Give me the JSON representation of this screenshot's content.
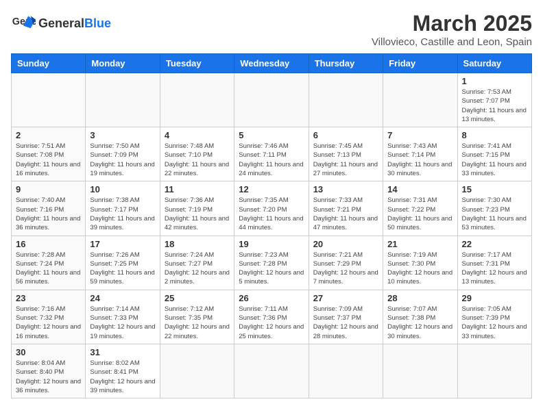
{
  "logo": {
    "text_general": "General",
    "text_blue": "Blue"
  },
  "title": "March 2025",
  "subtitle": "Villovieco, Castille and Leon, Spain",
  "weekdays": [
    "Sunday",
    "Monday",
    "Tuesday",
    "Wednesday",
    "Thursday",
    "Friday",
    "Saturday"
  ],
  "weeks": [
    [
      null,
      null,
      null,
      null,
      null,
      null,
      {
        "day": 1,
        "info": "Sunrise: 7:53 AM\nSunset: 7:07 PM\nDaylight: 11 hours and 13 minutes."
      }
    ],
    [
      {
        "day": 2,
        "info": "Sunrise: 7:51 AM\nSunset: 7:08 PM\nDaylight: 11 hours and 16 minutes."
      },
      {
        "day": 3,
        "info": "Sunrise: 7:50 AM\nSunset: 7:09 PM\nDaylight: 11 hours and 19 minutes."
      },
      {
        "day": 4,
        "info": "Sunrise: 7:48 AM\nSunset: 7:10 PM\nDaylight: 11 hours and 22 minutes."
      },
      {
        "day": 5,
        "info": "Sunrise: 7:46 AM\nSunset: 7:11 PM\nDaylight: 11 hours and 24 minutes."
      },
      {
        "day": 6,
        "info": "Sunrise: 7:45 AM\nSunset: 7:13 PM\nDaylight: 11 hours and 27 minutes."
      },
      {
        "day": 7,
        "info": "Sunrise: 7:43 AM\nSunset: 7:14 PM\nDaylight: 11 hours and 30 minutes."
      },
      {
        "day": 8,
        "info": "Sunrise: 7:41 AM\nSunset: 7:15 PM\nDaylight: 11 hours and 33 minutes."
      }
    ],
    [
      {
        "day": 9,
        "info": "Sunrise: 7:40 AM\nSunset: 7:16 PM\nDaylight: 11 hours and 36 minutes."
      },
      {
        "day": 10,
        "info": "Sunrise: 7:38 AM\nSunset: 7:17 PM\nDaylight: 11 hours and 39 minutes."
      },
      {
        "day": 11,
        "info": "Sunrise: 7:36 AM\nSunset: 7:19 PM\nDaylight: 11 hours and 42 minutes."
      },
      {
        "day": 12,
        "info": "Sunrise: 7:35 AM\nSunset: 7:20 PM\nDaylight: 11 hours and 44 minutes."
      },
      {
        "day": 13,
        "info": "Sunrise: 7:33 AM\nSunset: 7:21 PM\nDaylight: 11 hours and 47 minutes."
      },
      {
        "day": 14,
        "info": "Sunrise: 7:31 AM\nSunset: 7:22 PM\nDaylight: 11 hours and 50 minutes."
      },
      {
        "day": 15,
        "info": "Sunrise: 7:30 AM\nSunset: 7:23 PM\nDaylight: 11 hours and 53 minutes."
      }
    ],
    [
      {
        "day": 16,
        "info": "Sunrise: 7:28 AM\nSunset: 7:24 PM\nDaylight: 11 hours and 56 minutes."
      },
      {
        "day": 17,
        "info": "Sunrise: 7:26 AM\nSunset: 7:25 PM\nDaylight: 11 hours and 59 minutes."
      },
      {
        "day": 18,
        "info": "Sunrise: 7:24 AM\nSunset: 7:27 PM\nDaylight: 12 hours and 2 minutes."
      },
      {
        "day": 19,
        "info": "Sunrise: 7:23 AM\nSunset: 7:28 PM\nDaylight: 12 hours and 5 minutes."
      },
      {
        "day": 20,
        "info": "Sunrise: 7:21 AM\nSunset: 7:29 PM\nDaylight: 12 hours and 7 minutes."
      },
      {
        "day": 21,
        "info": "Sunrise: 7:19 AM\nSunset: 7:30 PM\nDaylight: 12 hours and 10 minutes."
      },
      {
        "day": 22,
        "info": "Sunrise: 7:17 AM\nSunset: 7:31 PM\nDaylight: 12 hours and 13 minutes."
      }
    ],
    [
      {
        "day": 23,
        "info": "Sunrise: 7:16 AM\nSunset: 7:32 PM\nDaylight: 12 hours and 16 minutes."
      },
      {
        "day": 24,
        "info": "Sunrise: 7:14 AM\nSunset: 7:33 PM\nDaylight: 12 hours and 19 minutes."
      },
      {
        "day": 25,
        "info": "Sunrise: 7:12 AM\nSunset: 7:35 PM\nDaylight: 12 hours and 22 minutes."
      },
      {
        "day": 26,
        "info": "Sunrise: 7:11 AM\nSunset: 7:36 PM\nDaylight: 12 hours and 25 minutes."
      },
      {
        "day": 27,
        "info": "Sunrise: 7:09 AM\nSunset: 7:37 PM\nDaylight: 12 hours and 28 minutes."
      },
      {
        "day": 28,
        "info": "Sunrise: 7:07 AM\nSunset: 7:38 PM\nDaylight: 12 hours and 30 minutes."
      },
      {
        "day": 29,
        "info": "Sunrise: 7:05 AM\nSunset: 7:39 PM\nDaylight: 12 hours and 33 minutes."
      }
    ],
    [
      {
        "day": 30,
        "info": "Sunrise: 8:04 AM\nSunset: 8:40 PM\nDaylight: 12 hours and 36 minutes."
      },
      {
        "day": 31,
        "info": "Sunrise: 8:02 AM\nSunset: 8:41 PM\nDaylight: 12 hours and 39 minutes."
      },
      null,
      null,
      null,
      null,
      null
    ]
  ]
}
